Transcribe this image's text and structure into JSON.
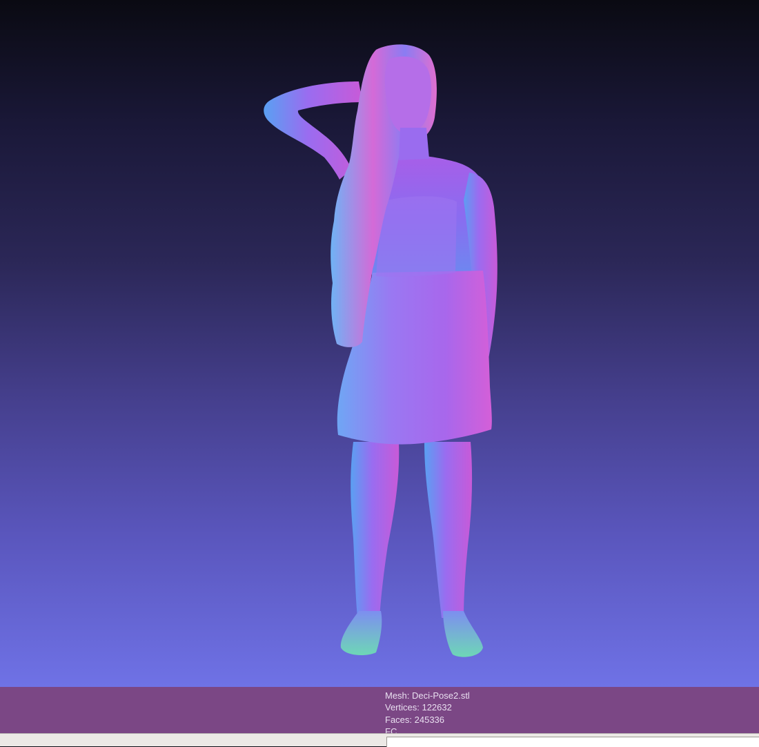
{
  "viewport": {
    "background_top": "#0a0a12",
    "background_bottom": "#6f72e6",
    "shading": "normal-map"
  },
  "info_panel": {
    "background": "#7b4785",
    "mesh": "Mesh: Deci-Pose2.stl",
    "vertices": "Vertices: 122632",
    "faces": "Faces: 245336",
    "fc": "FC"
  }
}
